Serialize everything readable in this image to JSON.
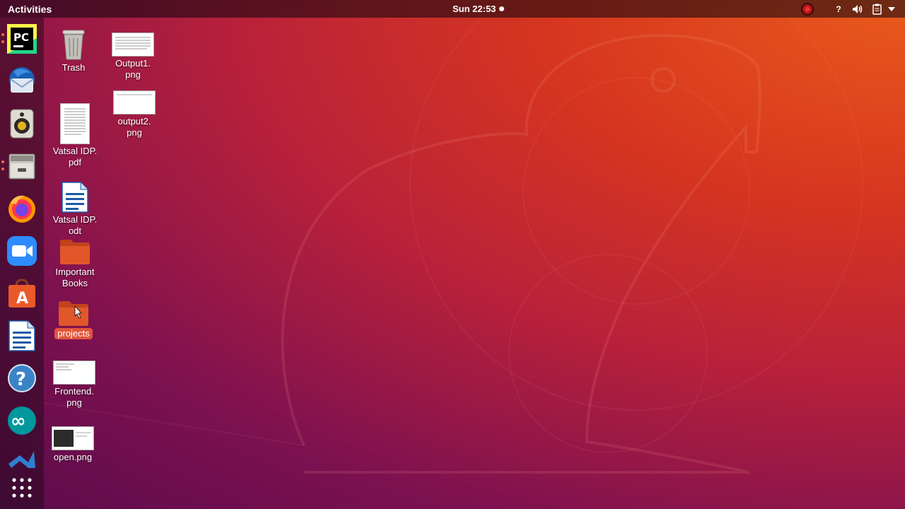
{
  "topbar": {
    "activities": "Activities",
    "clock": "Sun 22:53",
    "tray_icons": [
      "record-indicator-icon",
      "help-icon",
      "volume-icon",
      "clipboard-icon",
      "chevron-down-icon"
    ],
    "help_label": "?"
  },
  "dock": {
    "items": [
      {
        "name": "pycharm",
        "label": "PC",
        "running": true
      },
      {
        "name": "thunderbird",
        "running": false
      },
      {
        "name": "rhythmbox",
        "running": false
      },
      {
        "name": "files",
        "running": true
      },
      {
        "name": "firefox",
        "running": false
      },
      {
        "name": "zoom",
        "running": false
      },
      {
        "name": "ubuntu-software",
        "label": "A",
        "running": false
      },
      {
        "name": "libreoffice-writer",
        "running": false
      },
      {
        "name": "help",
        "label": "?",
        "running": false
      },
      {
        "name": "arduino",
        "label": "∞",
        "running": false
      },
      {
        "name": "vscode",
        "running": false
      }
    ],
    "show_apps": "show-applications"
  },
  "desktop": {
    "icons": [
      {
        "name": "trash",
        "label": "Trash"
      },
      {
        "name": "output1",
        "label": "Output1.\npng"
      },
      {
        "name": "output2",
        "label": "output2.\npng"
      },
      {
        "name": "vatsal-pdf",
        "label": "Vatsal IDP.\npdf"
      },
      {
        "name": "vatsal-odt",
        "label": "Vatsal IDP.\nodt"
      },
      {
        "name": "important-books",
        "label": "Important\nBooks"
      },
      {
        "name": "projects",
        "label": "projects",
        "selected": true
      },
      {
        "name": "frontend",
        "label": "Frontend.\npng"
      },
      {
        "name": "open",
        "label": "open.png"
      }
    ]
  },
  "colors": {
    "accent": "#e2553b",
    "wallpaper_top_right": "#e95a1c",
    "wallpaper_bottom_left": "#5c0b4b",
    "folder": "#e1572a"
  }
}
